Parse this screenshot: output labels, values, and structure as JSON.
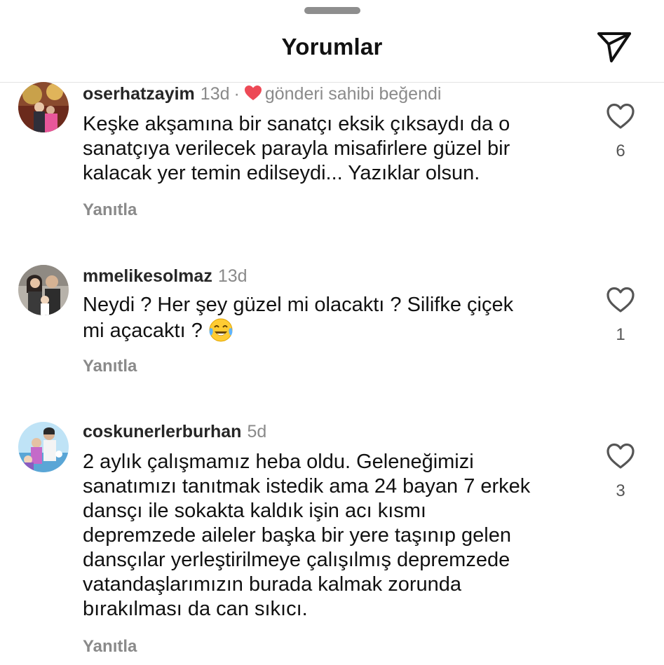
{
  "header": {
    "title": "Yorumlar",
    "share_icon": "paper-plane-icon"
  },
  "comments": [
    {
      "username": "oserhatzayim",
      "time": "13d",
      "owner_liked": true,
      "owner_liked_text": "gönderi sahibi beğendi",
      "lines": [
        "Keşke akşamına bir sanatçı eksik çıksaydı da o",
        "sanatçıya verilecek parayla misafirlere güzel bir",
        "kalacak yer temin edilseydi... Yazıklar olsun."
      ],
      "reply_label": "Yanıtla",
      "like_count": "6"
    },
    {
      "username": "mmelikesolmaz",
      "time": "13d",
      "owner_liked": false,
      "lines": [
        "Neydi ? Her şey güzel mi olacaktı ? Silifke çiçek",
        "mi açacaktı ?"
      ],
      "emoji": "face-with-tears-of-joy",
      "reply_label": "Yanıtla",
      "like_count": "1"
    },
    {
      "username": "coskunerlerburhan",
      "time": "5d",
      "owner_liked": false,
      "lines": [
        "2 aylık çalışmamız heba oldu. Geleneğimizi",
        "sanatımızı tanıtmak istedik ama 24 bayan 7 erkek",
        "dansçı ile sokakta kaldık işin acı kısmı",
        "depremzede aileler başka bir yere taşınıp gelen",
        "dansçılar yerleştirilmeye çalışılmış depremzede",
        "vatandaşlarımızın burada kalmak zorunda",
        "bırakılması da can sıkıcı."
      ],
      "reply_label": "Yanıtla",
      "like_count": "3"
    }
  ],
  "colors": {
    "owner_heart": "#ed4956",
    "muted_text": "#8a8a8a",
    "primary_text": "#111111",
    "divider": "#e3e3e3"
  }
}
